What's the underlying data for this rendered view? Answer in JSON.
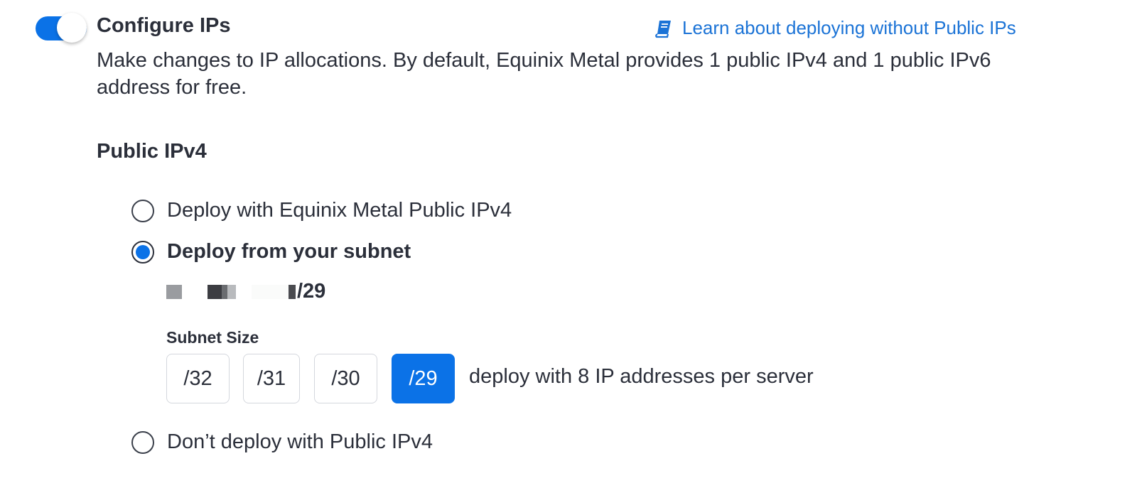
{
  "configure": {
    "title": "Configure IPs",
    "toggle_on": true,
    "description": "Make changes to IP allocations. By default, Equinix Metal provides 1 public IPv4 and 1 public IPv6 address for free.",
    "learn_link": "Learn about deploying without Public IPs",
    "learn_icon": "book-icon"
  },
  "public_ipv4": {
    "heading": "Public IPv4",
    "options": [
      {
        "label": "Deploy with Equinix Metal Public IPv4",
        "checked": false
      },
      {
        "label": "Deploy from your subnet",
        "checked": true
      },
      {
        "label": "Don’t deploy with Public IPv4",
        "checked": false
      }
    ],
    "subnet_suffix": "/29",
    "subnet_size_label": "Subnet Size",
    "subnet_sizes": [
      "/32",
      "/31",
      "/30",
      "/29"
    ],
    "selected_size": "/29",
    "size_description": "deploy with 8 IP addresses per server"
  },
  "colors": {
    "accent": "#0b72e7",
    "link": "#1b73d6",
    "text": "#2b2f3a"
  }
}
